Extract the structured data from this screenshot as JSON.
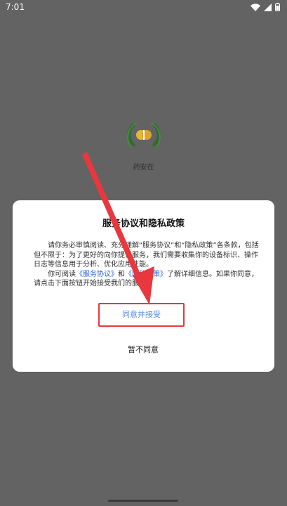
{
  "status_bar": {
    "time": "7:01"
  },
  "splash": {
    "app_name": "药安在"
  },
  "dialog": {
    "title": "服务协议和隐私政策",
    "paragraph1": "请你务必审慎阅读、充分理解“服务协议”和“隐私政策”各条款，包括但不限于：为了更好的向你提供服务，我们需要收集你的设备标识、操作日志等信息用于分析、优化应用性能。",
    "paragraph2_prefix": "你可阅读",
    "link_service": "《服务协议》",
    "paragraph2_and": "和",
    "link_privacy": "《隐私政策》",
    "paragraph2_suffix": "了解详细信息。如果你同意，请点击下面按钮开始接受我们的服务。",
    "accept_label": "同意并接受",
    "decline_label": "暂不同意"
  },
  "colors": {
    "backdrop": "#636363",
    "link": "#2f63e0",
    "highlight": "#e8383d",
    "accept_text": "#5a8be8"
  },
  "icons": {
    "status": [
      "wifi-icon",
      "signal-icon",
      "battery-icon"
    ],
    "logo": "app-logo-icon"
  }
}
